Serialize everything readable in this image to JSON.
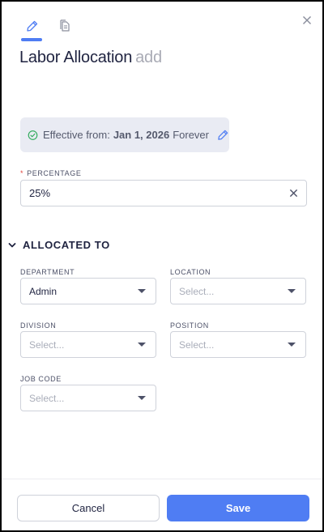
{
  "header": {
    "title": "Labor Allocation",
    "title_suffix": "add"
  },
  "effective": {
    "prefix": "Effective from:",
    "date": "Jan 1, 2026",
    "suffix": "Forever"
  },
  "percentage": {
    "label": "PERCENTAGE",
    "required_mark": "*",
    "value": "25%"
  },
  "allocated": {
    "heading": "ALLOCATED TO",
    "department": {
      "label": "DEPARTMENT",
      "value": "Admin"
    },
    "location": {
      "label": "LOCATION",
      "placeholder": "Select..."
    },
    "division": {
      "label": "DIVISION",
      "placeholder": "Select..."
    },
    "position": {
      "label": "POSITION",
      "placeholder": "Select..."
    },
    "job_code": {
      "label": "JOB CODE",
      "placeholder": "Select..."
    }
  },
  "footer": {
    "cancel": "Cancel",
    "save": "Save"
  },
  "colors": {
    "accent": "#4f7df3",
    "success": "#2eaa5a",
    "required": "#e0423b",
    "title": "#1f2340"
  },
  "icons": [
    "pencil-icon",
    "document-icon",
    "close-icon",
    "check-circle-icon",
    "edit-icon",
    "clear-icon",
    "chevron-down-icon",
    "dropdown-arrow-icon"
  ]
}
